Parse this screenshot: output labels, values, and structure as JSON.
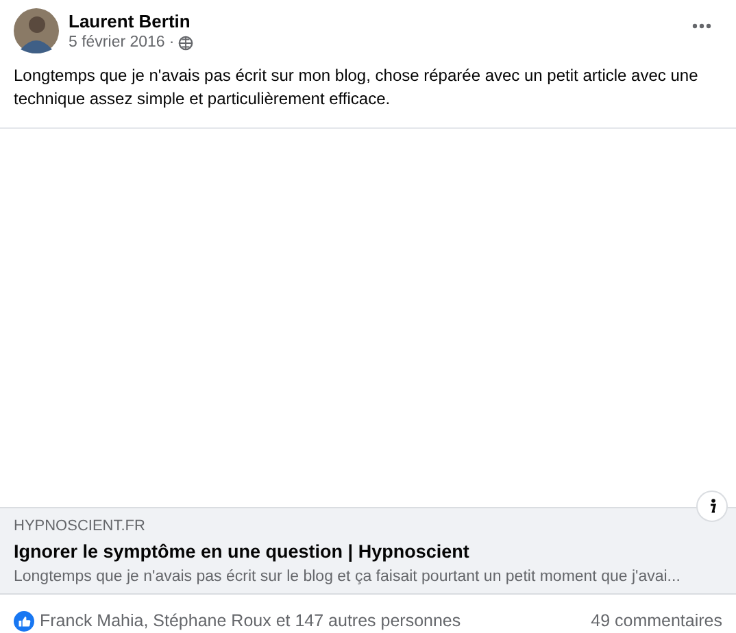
{
  "post": {
    "author": "Laurent Bertin",
    "date": "5 février 2016",
    "audience_separator": "·",
    "text": "Longtemps que je n'avais pas écrit sur mon blog, chose réparée avec un petit article avec une technique assez simple et particulièrement efficace."
  },
  "link_preview": {
    "domain": "HYPNOSCIENT.FR",
    "title": "Ignorer le symptôme en une question | Hypnoscient",
    "description": "Longtemps que je n'avais pas écrit sur le blog et ça faisait pourtant un petit moment que j'avai..."
  },
  "footer": {
    "reactions": "Franck Mahia, Stéphane Roux et 147 autres personnes",
    "comments": "49 commentaires"
  }
}
